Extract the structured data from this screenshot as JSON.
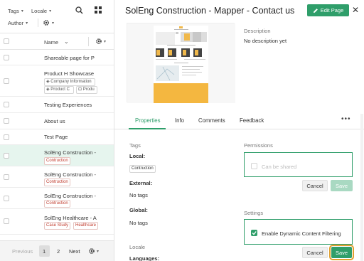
{
  "filters": {
    "tags_label": "Tags",
    "locale_label": "Locale",
    "author_label": "Author"
  },
  "table": {
    "col_name": "Name",
    "rows": [
      {
        "title": "Shareable page for P",
        "tags": []
      },
      {
        "title": "Product H Showcase",
        "tags": [
          "Company Information",
          "Product C",
          "Produ"
        ]
      },
      {
        "title": "Testing Experiences",
        "tags": []
      },
      {
        "title": "About us",
        "tags": []
      },
      {
        "title": "Test Page",
        "tags": []
      },
      {
        "title": "SolEng Construction -",
        "tags": [
          "Contruction"
        ]
      },
      {
        "title": "SolEng Construction -",
        "tags": [
          "Contruction"
        ]
      },
      {
        "title": "SolEng Construction -",
        "tags": [
          "Contruction"
        ]
      },
      {
        "title": "SolEng Healthcare - A",
        "tags": [
          "Case Study",
          "Healthcare"
        ]
      }
    ]
  },
  "pager": {
    "previous": "Previous",
    "page1": "1",
    "page2": "2",
    "next": "Next"
  },
  "header": {
    "title": "SolEng Construction - Mapper - Contact us",
    "edit_label": "Edit Page"
  },
  "description": {
    "label": "Description",
    "value": "No description yet"
  },
  "tabs": [
    "Properties",
    "Info",
    "Comments",
    "Feedback"
  ],
  "properties": {
    "tags_label": "Tags",
    "local_label": "Local:",
    "local_tag": "Contruction",
    "external_label": "External:",
    "external_value": "No tags",
    "global_label": "Global:",
    "global_value": "No tags",
    "locale_label": "Locale",
    "languages_label": "Languages:"
  },
  "permissions": {
    "label": "Permissions",
    "can_be_shared": "Can be shared",
    "cancel": "Cancel",
    "save": "Save"
  },
  "settings": {
    "label": "Settings",
    "dynamic_filtering": "Enable Dynamic Content Filtering",
    "cancel": "Cancel",
    "save": "Save"
  },
  "colors": {
    "accent": "#2f9e6a",
    "selected_row": "#e6f5ee",
    "highlight": "#e0a030"
  }
}
